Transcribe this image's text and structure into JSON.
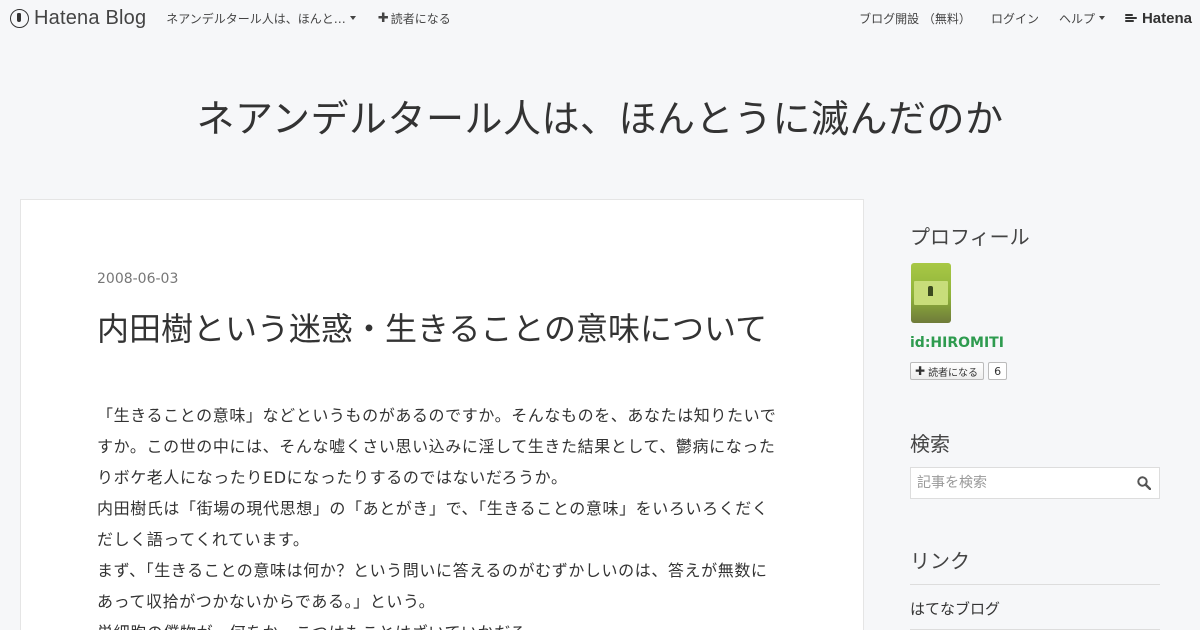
{
  "header": {
    "brand": "Hatena Blog",
    "blog_select_label": "ネアンデルタール人は、ほんと…",
    "subscribe_label": "読者になる",
    "open_blog_label": "ブログ開設 （無料）",
    "login_label": "ログイン",
    "help_label": "ヘルプ",
    "hatena_label": "Hatena"
  },
  "blog": {
    "title": "ネアンデルタール人は、ほんとうに滅んだのか"
  },
  "entry": {
    "date": "2008-06-03",
    "title": "内田樹という迷惑・生きることの意味について",
    "paragraphs": [
      "「生きることの意味」などというものがあるのですか。そんなものを、あなたは知りたいですか。この世の中には、そんな嘘くさい思い込みに淫して生きた結果として、鬱病になったりボケ老人になったりEDになったりするのではないだろうか。",
      "内田樹氏は「街場の現代思想」の「あとがき」で、「生きることの意味」をいろいろくだくだしく語ってくれています。",
      "まず、「生きることの意味は何か？という問いに答えるのがむずかしいのは、答えが無数にあって収拾がつかないからである。」という。",
      "単細胞の僕物が、何をか、こつはもことはざいていかだろ"
    ]
  },
  "sidebar": {
    "profile": {
      "title": "プロフィール",
      "user_id": "id:HIROMITI",
      "follow_label": "読者になる",
      "follower_count": "6"
    },
    "search": {
      "title": "検索",
      "placeholder": "記事を検索"
    },
    "links": {
      "title": "リンク",
      "items": [
        "はてなブログ"
      ]
    }
  },
  "colors": {
    "background": "#f6f7f9",
    "profile_id": "#2e9b4f",
    "text": "#333333"
  }
}
